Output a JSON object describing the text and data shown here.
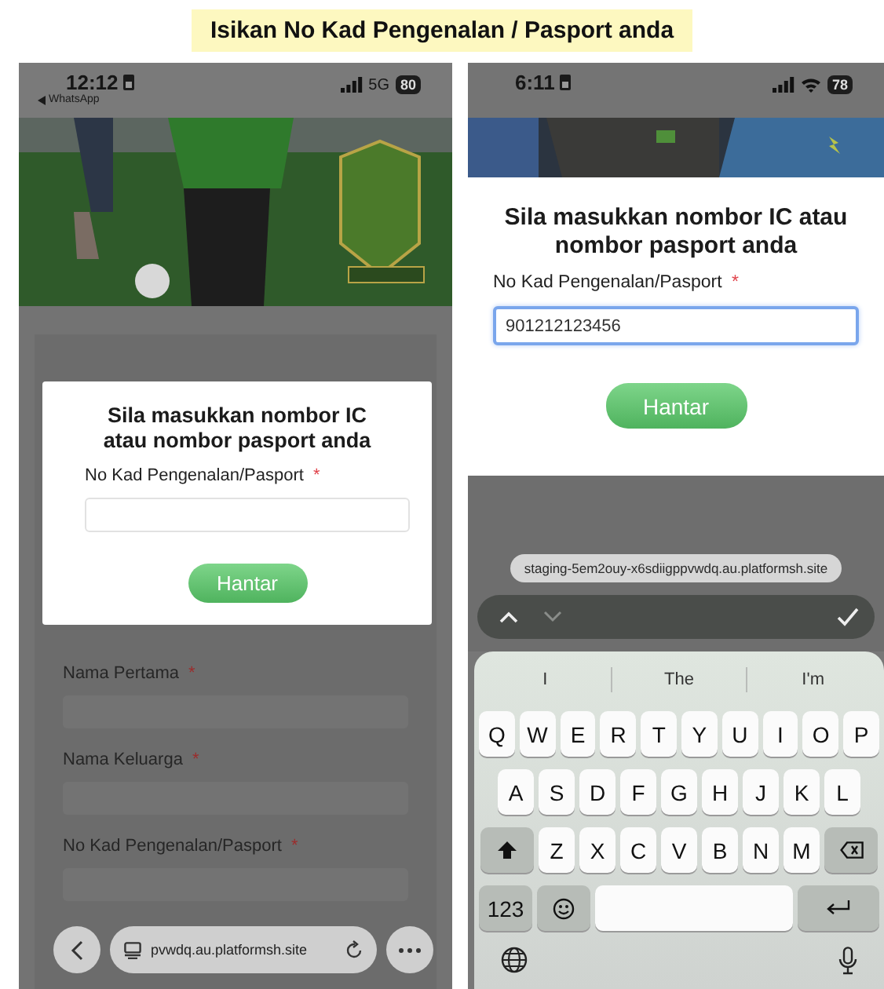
{
  "banner": {
    "title": "Isikan No Kad Pengenalan / Pasport anda"
  },
  "screens": [
    {
      "kind": "dialog_over_form",
      "status_bar": {
        "time": "12:12",
        "back_app": "WhatsApp",
        "network": "5G",
        "battery": "80"
      },
      "dialog": {
        "title": "Sila masukkan nombor IC atau nombor pasport anda",
        "field": {
          "label": "No Kad Pengenalan/Pasport",
          "required_mark": "*",
          "focused": false
        },
        "submit": "Hantar"
      },
      "form_fields": [
        {
          "label": "Nama Pertama",
          "required_mark": "*"
        },
        {
          "label": "Nama Keluarga",
          "required_mark": "*"
        },
        {
          "label": "No Kad Pengenalan/Pasport",
          "required_mark": "*"
        }
      ],
      "browser_bar": {
        "url": "pvwdq.au.platformsh.site"
      }
    },
    {
      "kind": "keyboard_entry",
      "status_bar": {
        "time": "6:11",
        "wifi": true,
        "battery": "78"
      },
      "dialog": {
        "title": "Sila masukkan nombor IC atau nombor pasport anda",
        "field": {
          "label": "No Kad Pengenalan/Pasport",
          "required_mark": "*",
          "value": "901212123456",
          "focused": true
        },
        "submit": "Hantar"
      },
      "url_pill": "staging-5em2ouy-x6sdiigppvwdq.au.platformsh.site",
      "keyboard": {
        "suggestions": [
          "I",
          "The",
          "I'm"
        ],
        "rows": [
          [
            "Q",
            "W",
            "E",
            "R",
            "T",
            "Y",
            "U",
            "I",
            "O",
            "P"
          ],
          [
            "A",
            "S",
            "D",
            "F",
            "G",
            "H",
            "J",
            "K",
            "L"
          ],
          [
            "Z",
            "X",
            "C",
            "V",
            "B",
            "N",
            "M"
          ]
        ],
        "number_key": "123"
      }
    }
  ]
}
